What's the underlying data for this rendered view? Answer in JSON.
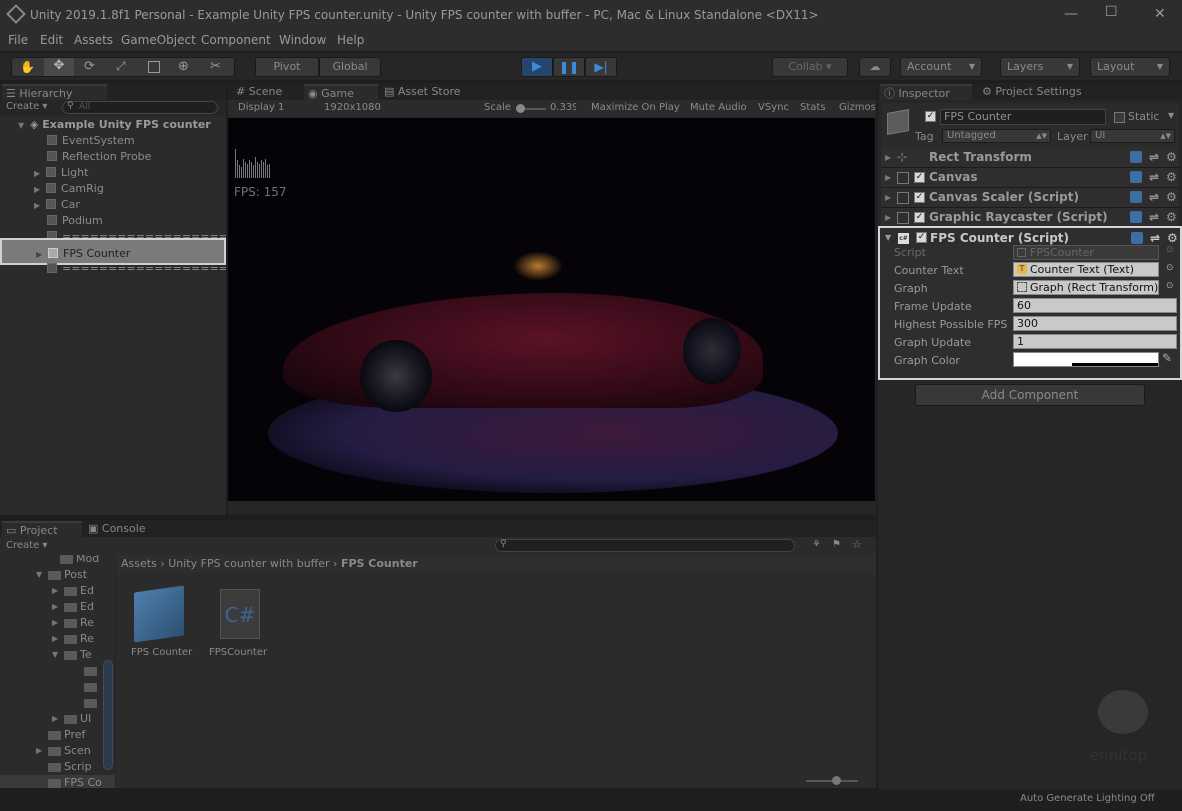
{
  "window": {
    "title": "Unity 2019.1.8f1 Personal - Example Unity FPS counter.unity - Unity FPS counter with buffer - PC, Mac & Linux Standalone <DX11>",
    "minimize": "—",
    "maximize": "☐",
    "close": "✕"
  },
  "menu": [
    "File",
    "Edit",
    "Assets",
    "GameObject",
    "Component",
    "Window",
    "Help"
  ],
  "toolbar": {
    "pivot": "Pivot",
    "global": "Global",
    "collab": "Collab ▾",
    "account": "Account",
    "layers": "Layers",
    "layout": "Layout"
  },
  "hierarchy": {
    "tab": "Hierarchy",
    "create": "Create ▾",
    "search_placeholder": "All",
    "scene_name": "Example Unity FPS counter",
    "items": [
      {
        "label": "EventSystem"
      },
      {
        "label": "Reflection Probe"
      },
      {
        "label": "Light"
      },
      {
        "label": "CamRig"
      },
      {
        "label": "Car"
      },
      {
        "label": "Podium"
      },
      {
        "label": "===================="
      },
      {
        "label": "FPS Counter"
      },
      {
        "label": "===================="
      }
    ]
  },
  "scene_tabs": {
    "scene": "Scene",
    "game": "Game",
    "asset_store": "Asset Store"
  },
  "game_toolbar": {
    "display": "Display 1",
    "resolution": "1920x1080",
    "scale_label": "Scale",
    "scale_value": "0.339",
    "maximize": "Maximize On Play",
    "mute": "Mute Audio",
    "vsync": "VSync",
    "stats": "Stats",
    "gizmos": "Gizmos"
  },
  "game_view": {
    "fps_text": "FPS: 157",
    "graph_bars": [
      0.9,
      0.55,
      0.4,
      0.35,
      0.6,
      0.5,
      0.45,
      0.55,
      0.5,
      0.4,
      0.65,
      0.5,
      0.45,
      0.55,
      0.5,
      0.6,
      0.4,
      0.45
    ]
  },
  "inspector": {
    "tab": "Inspector",
    "project_settings_tab": "Project Settings",
    "object_name": "FPS Counter",
    "static": "Static",
    "tag_label": "Tag",
    "tag_value": "Untagged",
    "layer_label": "Layer",
    "layer_value": "UI",
    "components": [
      "Rect Transform",
      "Canvas",
      "Canvas Scaler (Script)",
      "Graphic Raycaster (Script)",
      "FPS Counter (Script)"
    ],
    "properties": [
      {
        "label": "Script",
        "value": "FPSCounter"
      },
      {
        "label": "Counter Text",
        "value": "Counter Text (Text)"
      },
      {
        "label": "Graph",
        "value": "Graph (Rect Transform)"
      },
      {
        "label": "Frame Update",
        "value": "60"
      },
      {
        "label": "Highest Possible FPS",
        "value": "300"
      },
      {
        "label": "Graph Update",
        "value": "1"
      },
      {
        "label": "Graph Color",
        "value": ""
      }
    ],
    "add_component": "Add Component"
  },
  "project": {
    "tab": "Project",
    "console_tab": "Console",
    "create": "Create ▾",
    "tree": [
      {
        "label": "Mod"
      },
      {
        "label": "Post"
      },
      {
        "label": "Ed"
      },
      {
        "label": "Ed"
      },
      {
        "label": "Re"
      },
      {
        "label": "Re"
      },
      {
        "label": "Te"
      },
      {
        "label": ""
      },
      {
        "label": ""
      },
      {
        "label": ""
      },
      {
        "label": "UI"
      },
      {
        "label": "Pref"
      },
      {
        "label": "Scen"
      },
      {
        "label": "Scrip"
      },
      {
        "label": "FPS Co"
      }
    ],
    "breadcrumb": [
      "Assets",
      "Unity FPS counter with buffer",
      "FPS Counter"
    ],
    "assets": [
      {
        "label": "FPS Counter",
        "icon": "prefab-cube-icon"
      },
      {
        "label": "FPSCounter",
        "icon": "csharp-script-icon",
        "glyph": "C#"
      }
    ]
  },
  "statusbar": {
    "text": "Auto Generate Lighting Off"
  },
  "watermark": {
    "text": "ennitop"
  }
}
